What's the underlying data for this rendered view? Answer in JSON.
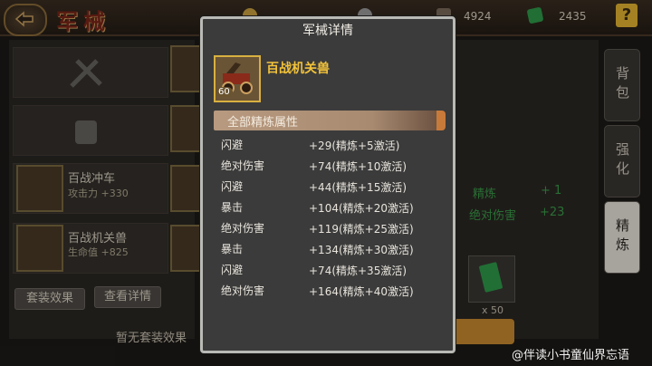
{
  "header": {
    "title": "军械",
    "resources": [
      {
        "icon": "gold-coin-icon",
        "value": "",
        "color": "#c9a040"
      },
      {
        "icon": "silver-icon",
        "value": "",
        "color": "#9a9a9a"
      },
      {
        "icon": "ore-icon",
        "value": "4924",
        "color": "#7a6a5a"
      },
      {
        "icon": "green-book-icon",
        "value": "2435",
        "color": "#2e9a4a"
      }
    ],
    "help_label": "?"
  },
  "list": {
    "items": [
      {
        "name": "百战冲车",
        "stat": "攻击力 +330"
      },
      {
        "name": "百战机关兽",
        "stat": "生命值 +825"
      }
    ],
    "set_effect_button": "套装效果",
    "view_detail_button": "查看详情",
    "no_set_text": "暂无套装效果"
  },
  "right": {
    "tabs": [
      "背包",
      "强化",
      "精炼"
    ],
    "refine_label": "精炼",
    "refine_value": "+ 1",
    "refine_attr": "绝对伤害",
    "refine_attr_value": "+23",
    "material_count": "x 50"
  },
  "modal": {
    "title": "军械详情",
    "item_name": "百战机关兽",
    "item_level": "60",
    "section_title": "全部精炼属性",
    "attributes": [
      {
        "name": "闪避",
        "value": "+29(精炼+5激活)"
      },
      {
        "name": "绝对伤害",
        "value": "+74(精炼+10激活)"
      },
      {
        "name": "闪避",
        "value": "+44(精炼+15激活)"
      },
      {
        "name": "暴击",
        "value": "+104(精炼+20激活)"
      },
      {
        "name": "绝对伤害",
        "value": "+119(精炼+25激活)"
      },
      {
        "name": "暴击",
        "value": "+134(精炼+30激活)"
      },
      {
        "name": "闪避",
        "value": "+74(精炼+35激活)"
      },
      {
        "name": "绝对伤害",
        "value": "+164(精炼+40激活)"
      }
    ]
  },
  "watermark": "@伴读小书童仙界忘语"
}
